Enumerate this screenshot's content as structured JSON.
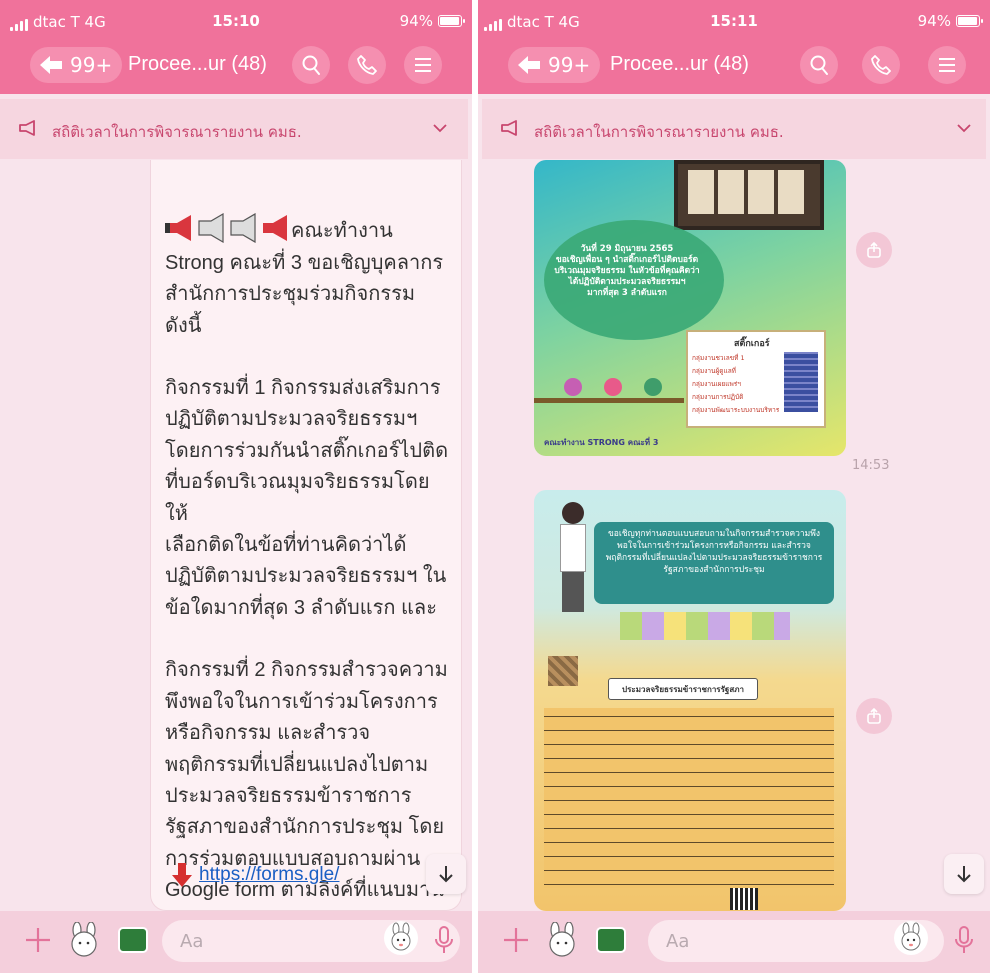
{
  "left": {
    "status": {
      "carrier": "dtac T 4G",
      "time": "15:10",
      "battery": "94%"
    },
    "header": {
      "back_count": "99+",
      "title": "Procee...ur (48)"
    },
    "announcement": "สถิติเวลาในการพิจารณารายงาน คมธ.",
    "message": {
      "first_line": "คณะทำงาน",
      "paragraph1": "Strong คณะที่ 3 ขอเชิญบุคลากร\nสำนักการประชุมร่วมกิจกรรม ดังนี้",
      "paragraph2": "กิจกรรมที่ 1 กิจกรรมส่งเสริมการ\nปฏิบัติตามประมวลจริยธรรมฯ\nโดยการร่วมกันนำสติ๊กเกอร์ไปติด\nที่บอร์ดบริเวณมุมจริยธรรมโดยให้\nเลือกติดในข้อที่ท่านคิดว่าได้\nปฏิบัติตามประมวลจริยธรรมฯ ใน\nข้อใดมากที่สุด 3 ลำดับแรก และ",
      "paragraph3": "กิจกรรมที่ 2 กิจกรรมสำรวจความ\nพึงพอใจในการเข้าร่วมโครงการ\nหรือกิจกรรม  และสำรวจ\nพฤติกรรมที่เปลี่ยนแปลงไปตาม\nประมวลจริยธรรมข้าราชการ\nรัฐสภาของสำนักการประชุม โดย\nการร่วมตอบแบบสอบถามผ่าน\nGoogle form ตามลิงค์ที่แนบมานี้",
      "link": "https://forms.gle/"
    },
    "input_placeholder": "Aa"
  },
  "right": {
    "status": {
      "carrier": "dtac T 4G",
      "time": "15:11",
      "battery": "94%"
    },
    "header": {
      "back_count": "99+",
      "title": "Procee...ur (48)"
    },
    "announcement": "สถิติเวลาในการพิจารณารายงาน คมธ.",
    "poster1": {
      "caption": "วันที่ 29 มิถุนายน 2565\nขอเชิญเพื่อน ๆ นำสติ๊กเกอร์ไปติดบอร์ด\nบริเวณมุมจริยธรรม ในหัวข้อที่คุณคิดว่า\nได้ปฏิบัติตามประมวลจริยธรรมฯ\nมากที่สุด 3 ลำดับแรก",
      "legend_title": "สติ๊กเกอร์",
      "legend": [
        "กลุ่มงานชวเลขที่ 1",
        "กลุ่มงานผู้ดูแลที่",
        "กลุ่มงานเผยแพร่ฯ",
        "กลุ่มงานการปฏิบัติ",
        "กลุ่มงานพัฒนาระบบงานบริหาร"
      ],
      "footer": "คณะทำงาน STRONG คณะที่ 3",
      "time": "14:53"
    },
    "poster2": {
      "banner": "ขอเชิญทุกท่านตอบแบบสอบถามในกิจกรรมสำรวจความพึงพอใจในการเข้าร่วมโครงการหรือกิจกรรม และสำรวจพฤติกรรมที่เปลี่ยนแปลงไปตามประมวลจริยธรรมข้าราชการรัฐสภาของสำนักการประชุม",
      "heading": "ประมวลจริยธรรมข้าราชการรัฐสภา"
    },
    "input_placeholder": "Aa"
  },
  "colors": {
    "header": "#f0729b",
    "background": "#f8e4ec",
    "accent_text": "#c8466e",
    "link": "#1b5fc4"
  }
}
